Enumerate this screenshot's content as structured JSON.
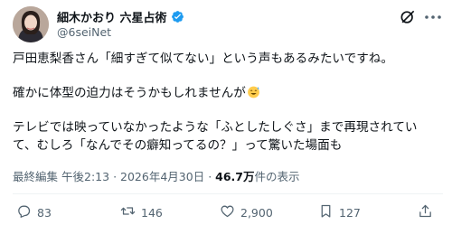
{
  "author": {
    "display_name": "細木かおり 六星占術",
    "handle": "@6seiNet",
    "verified": true
  },
  "post": {
    "line1": "戸田恵梨香さん「細すぎて似てない」という声もあるみたいですね。",
    "line2": "確かに体型の迫力はそうかもしれませんが",
    "line2_emoji": "sweat-smile-emoji",
    "line3": "テレビでは映っていなかったような「ふとしたしぐさ」まで再現されてい",
    "line4": "て、むしろ「なんでその癖知ってるの？」って驚いた場面も"
  },
  "meta": {
    "edited_label": "最終編集",
    "time": "午後2:13",
    "separator": "·",
    "date": "2026年4月30日",
    "views_count": "46.7万",
    "views_label": "件の表示"
  },
  "actions": {
    "replies": "83",
    "retweets": "146",
    "likes": "2,900",
    "bookmarks": "127"
  },
  "colors": {
    "text_primary": "#0f1419",
    "text_secondary": "#536471",
    "verified_blue": "#1d9bf0",
    "divider": "#eff3f4"
  }
}
